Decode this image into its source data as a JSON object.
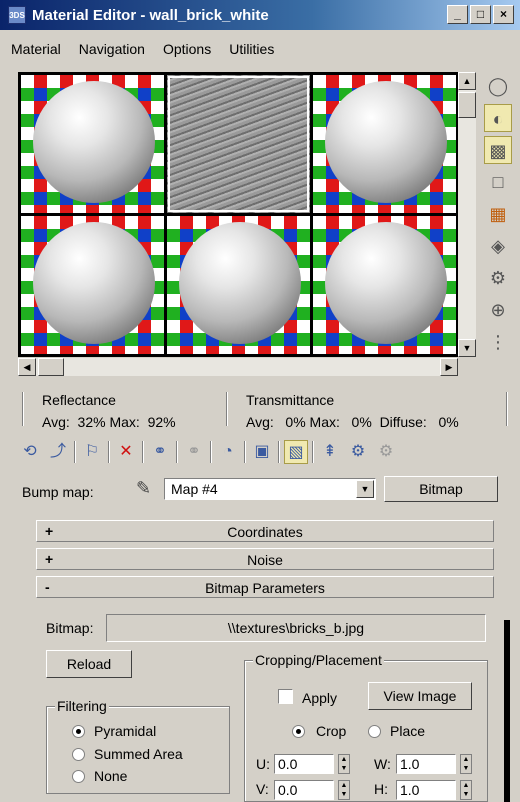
{
  "window": {
    "icon_text": "3DS",
    "title": "Material Editor - wall_brick_white",
    "controls": [
      "_",
      "□",
      "×"
    ]
  },
  "menu": [
    "Material",
    "Navigation",
    "Options",
    "Utilities"
  ],
  "stats": {
    "reflectance_label": "Reflectance",
    "reflectance_values": "Avg:  32% Max:  92%",
    "transmittance_label": "Transmittance",
    "transmittance_values": "Avg:   0% Max:   0%  Diffuse:   0%"
  },
  "bump": {
    "label": "Bump map:",
    "map_name": "Map #4",
    "type_button": "Bitmap"
  },
  "rollouts": {
    "coordinates": {
      "sign": "+",
      "title": "Coordinates"
    },
    "noise": {
      "sign": "+",
      "title": "Noise"
    },
    "bitmap_params": {
      "sign": "-",
      "title": "Bitmap Parameters"
    }
  },
  "bitmap": {
    "label": "Bitmap:",
    "path": "\\\\textures\\bricks_b.jpg",
    "reload": "Reload"
  },
  "filtering": {
    "title": "Filtering",
    "options": [
      "Pyramidal",
      "Summed Area",
      "None"
    ],
    "selected": "Pyramidal"
  },
  "cropping": {
    "title": "Cropping/Placement",
    "apply_label": "Apply",
    "apply_checked": false,
    "view_image": "View Image",
    "mode_options": [
      "Crop",
      "Place"
    ],
    "mode_selected": "Crop",
    "u_label": "U:",
    "u_value": "0.0",
    "v_label": "V:",
    "v_value": "0.0",
    "w_label": "W:",
    "w_value": "1.0",
    "h_label": "H:",
    "h_value": "1.0"
  },
  "colors": {
    "titlebar_start": "#0a246a",
    "titlebar_end": "#a6caf0",
    "panel": "#d4d0c8",
    "active_tool": "#f0e9b0"
  }
}
